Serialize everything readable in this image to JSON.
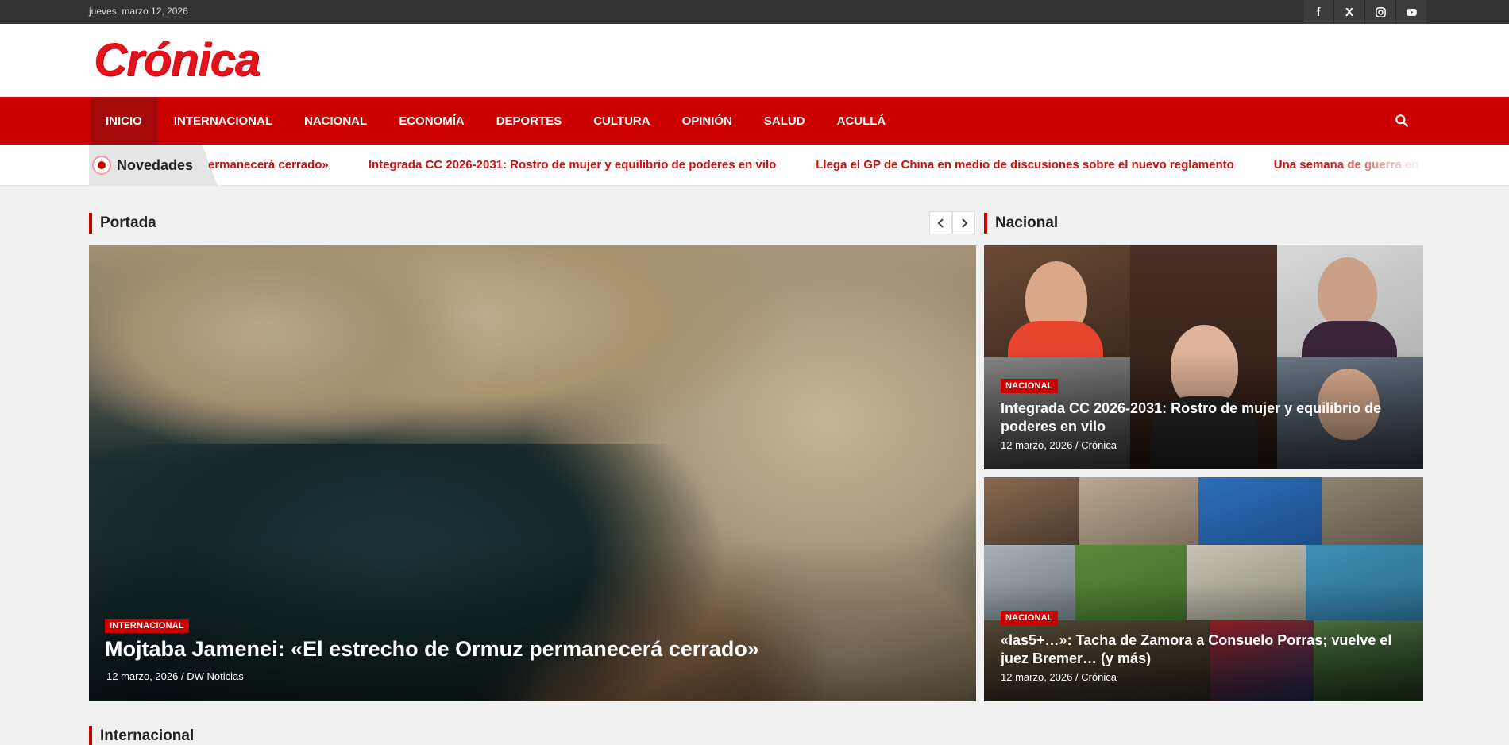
{
  "topbar": {
    "date": "jueves, marzo 12, 2026",
    "social": [
      {
        "icon": "facebook-icon",
        "glyph": "f"
      },
      {
        "icon": "x-icon",
        "glyph": "X"
      },
      {
        "icon": "instagram-icon",
        "glyph": ""
      },
      {
        "icon": "youtube-icon",
        "glyph": ""
      }
    ]
  },
  "header": {
    "logo": "Crónica"
  },
  "nav": {
    "items": [
      "INICIO",
      "INTERNACIONAL",
      "NACIONAL",
      "ECONOMÍA",
      "DEPORTES",
      "CULTURA",
      "OPINIÓN",
      "SALUD",
      "ACULLÁ"
    ],
    "search_icon": "search-icon"
  },
  "ticker": {
    "label": "Novedades",
    "items": [
      "ermanecerá cerrado»",
      "Integrada CC 2026-2031: Rostro de mujer y equilibrio de poderes en vilo",
      "Llega el GP de China en medio de discusiones sobre el nuevo reglamento",
      "Una semana de guerra en Irán ha costado"
    ]
  },
  "portada": {
    "title": "Portada",
    "hero": {
      "category": "INTERNACIONAL",
      "headline": "Mojtaba Jamenei: «El estrecho de Ormuz permanecerá cerrado»",
      "date": "12 marzo, 2026",
      "author": "DW Noticias"
    }
  },
  "nacional": {
    "title": "Nacional",
    "cards": [
      {
        "category": "NACIONAL",
        "headline": "Integrada CC 2026-2031: Rostro de mujer y equilibrio de poderes en vilo",
        "date": "12 marzo, 2026",
        "author": "Crónica"
      },
      {
        "category": "NACIONAL",
        "headline": "«las5+…»: Tacha de Zamora a Consuelo Porras; vuelve el juez Bremer… (y más)",
        "date": "12 marzo, 2026",
        "author": "Crónica"
      }
    ]
  },
  "internacional": {
    "title": "Internacional"
  },
  "colors": {
    "brand_red": "#cc0000",
    "logo_red": "#e3121b",
    "topbar": "#333333",
    "background": "#f1f1f1"
  }
}
